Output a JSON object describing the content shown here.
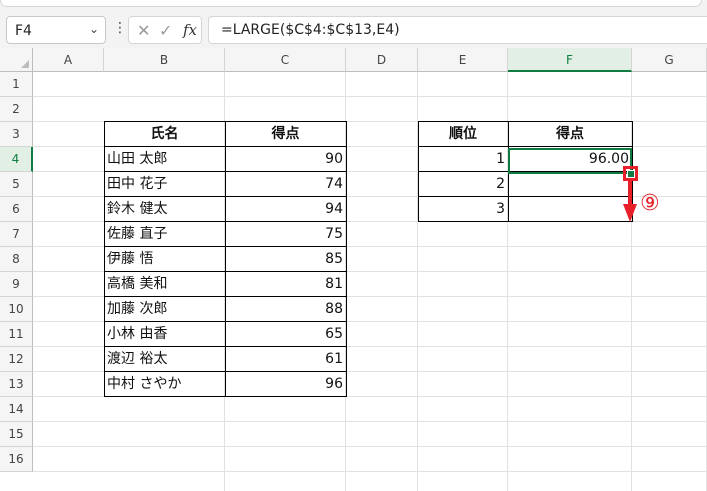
{
  "namebox": {
    "value": "F4"
  },
  "formula_bar": {
    "more_icon": "⋮",
    "cancel_icon": "✕",
    "enter_icon": "✓",
    "fx_label": "fx",
    "formula": "=LARGE($C$4:$C$13,E4)"
  },
  "columns": [
    "A",
    "B",
    "C",
    "D",
    "E",
    "F",
    "G"
  ],
  "rows": [
    "1",
    "2",
    "3",
    "4",
    "5",
    "6",
    "7",
    "8",
    "9",
    "10",
    "11",
    "12",
    "13",
    "14",
    "15",
    "16"
  ],
  "selected": {
    "column": "F",
    "row": "4"
  },
  "score_table": {
    "headers": [
      "氏名",
      "得点"
    ],
    "rows": [
      [
        "山田 太郎",
        "90"
      ],
      [
        "田中 花子",
        "74"
      ],
      [
        "鈴木 健太",
        "94"
      ],
      [
        "佐藤 直子",
        "75"
      ],
      [
        "伊藤 悟",
        "85"
      ],
      [
        "高橋 美和",
        "81"
      ],
      [
        "加藤 次郎",
        "88"
      ],
      [
        "小林 由香",
        "65"
      ],
      [
        "渡辺 裕太",
        "61"
      ],
      [
        "中村 さやか",
        "96"
      ]
    ]
  },
  "rank_table": {
    "headers": [
      "順位",
      "得点"
    ],
    "rows": [
      [
        "1",
        "96.00"
      ],
      [
        "2",
        ""
      ],
      [
        "3",
        ""
      ]
    ]
  },
  "annotation": {
    "step_label": "⑨",
    "color": "#e8202a"
  },
  "colors": {
    "accent": "#107c41"
  }
}
